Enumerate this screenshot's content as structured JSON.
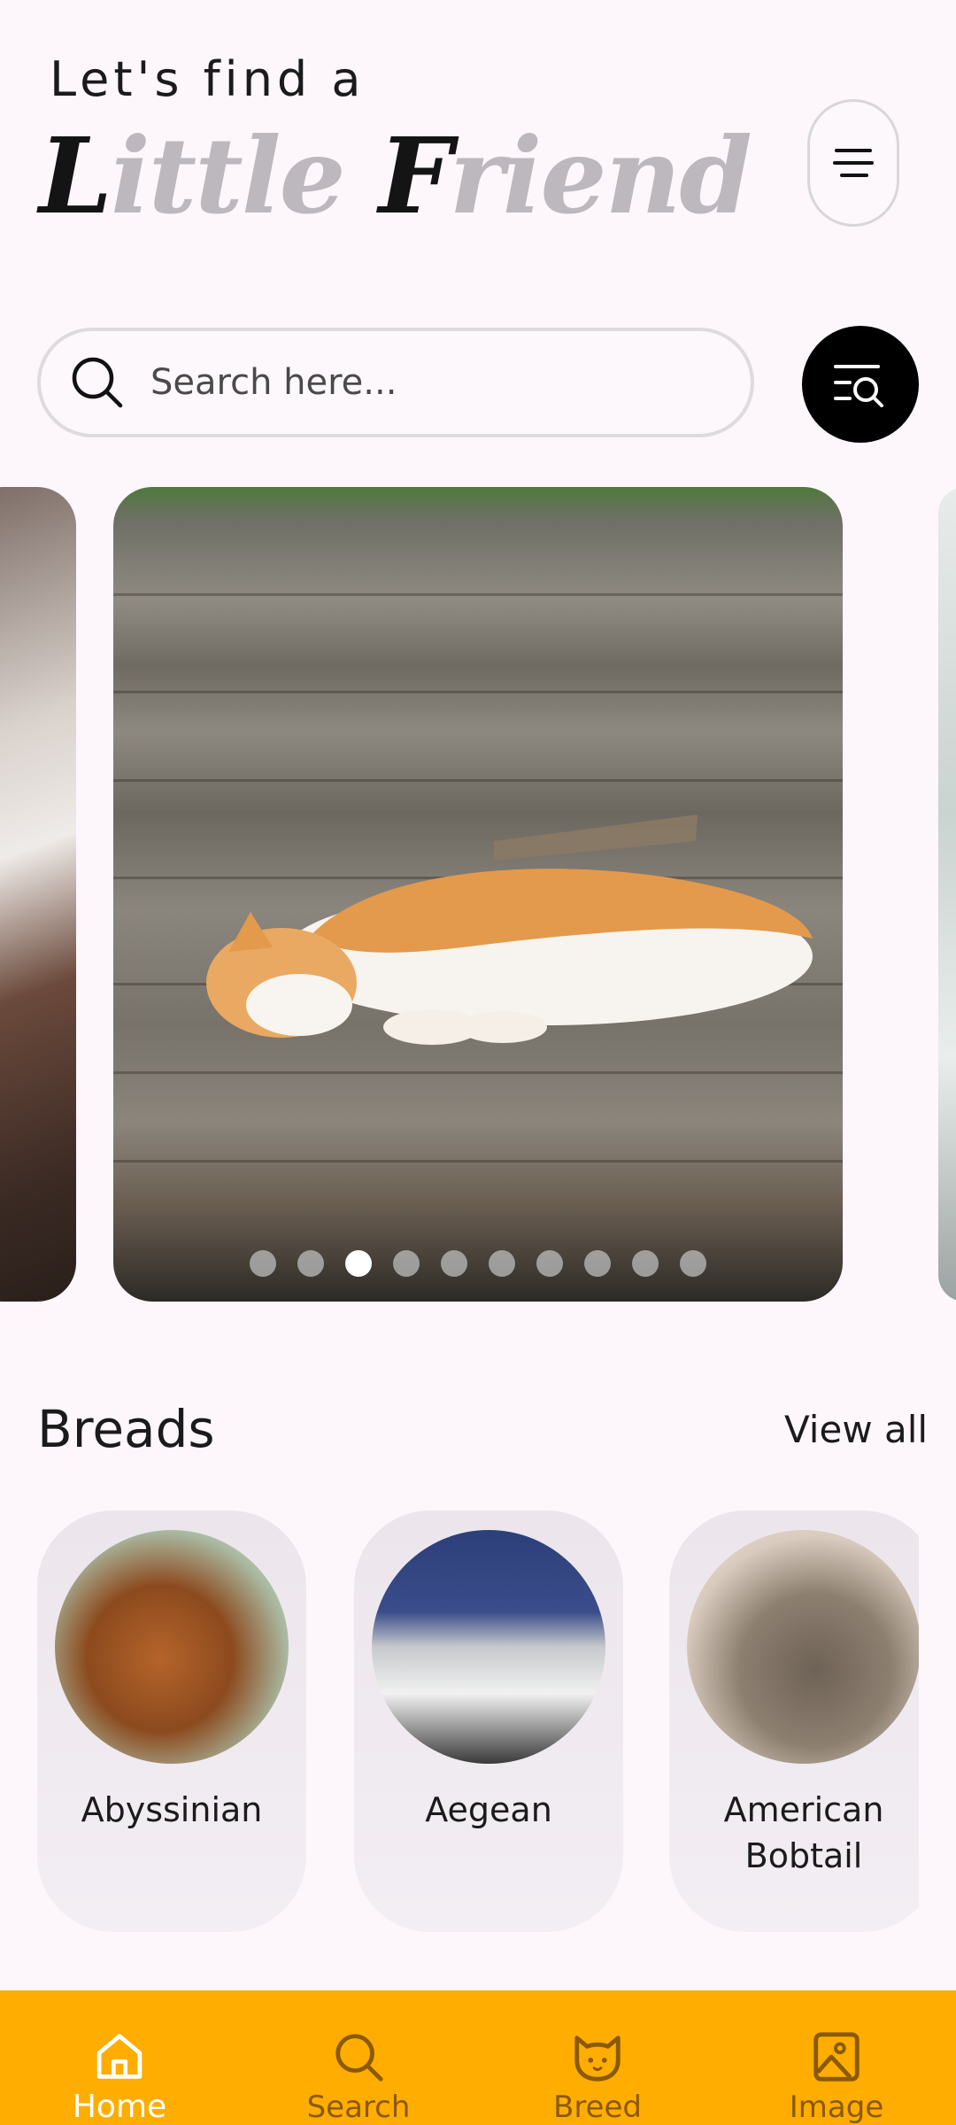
{
  "header": {
    "greeting": "Let's find a",
    "brand_part1_dark": "L",
    "brand_part1_light": "ittle ",
    "brand_part2_dark": "F",
    "brand_part2_light": "riend",
    "menu_icon": "menu-icon"
  },
  "search": {
    "placeholder": "Search here...",
    "value": "",
    "icon": "search-icon",
    "filter_icon": "filter-search-icon"
  },
  "carousel": {
    "total_slides": 10,
    "active_index": 2
  },
  "breeds_section": {
    "title": "Breads",
    "view_all_label": "View all",
    "items": [
      {
        "name": "Abyssinian"
      },
      {
        "name": "Aegean"
      },
      {
        "name": "American Bobtail"
      }
    ]
  },
  "bottom_nav": {
    "items": [
      {
        "label": "Home",
        "icon": "home-icon",
        "active": true
      },
      {
        "label": "Search",
        "icon": "search-icon",
        "active": false
      },
      {
        "label": "Breed",
        "icon": "cat-icon",
        "active": false
      },
      {
        "label": "Image",
        "icon": "image-icon",
        "active": false
      }
    ]
  },
  "colors": {
    "background": "#FDF7FC",
    "nav_bar": "#FFAD00",
    "nav_active_label": "#FFFFFF",
    "nav_inactive_label": "#8A5A00",
    "filter_button": "#000000",
    "brand_dark": "#141414",
    "brand_light": "#BDB8BE"
  }
}
